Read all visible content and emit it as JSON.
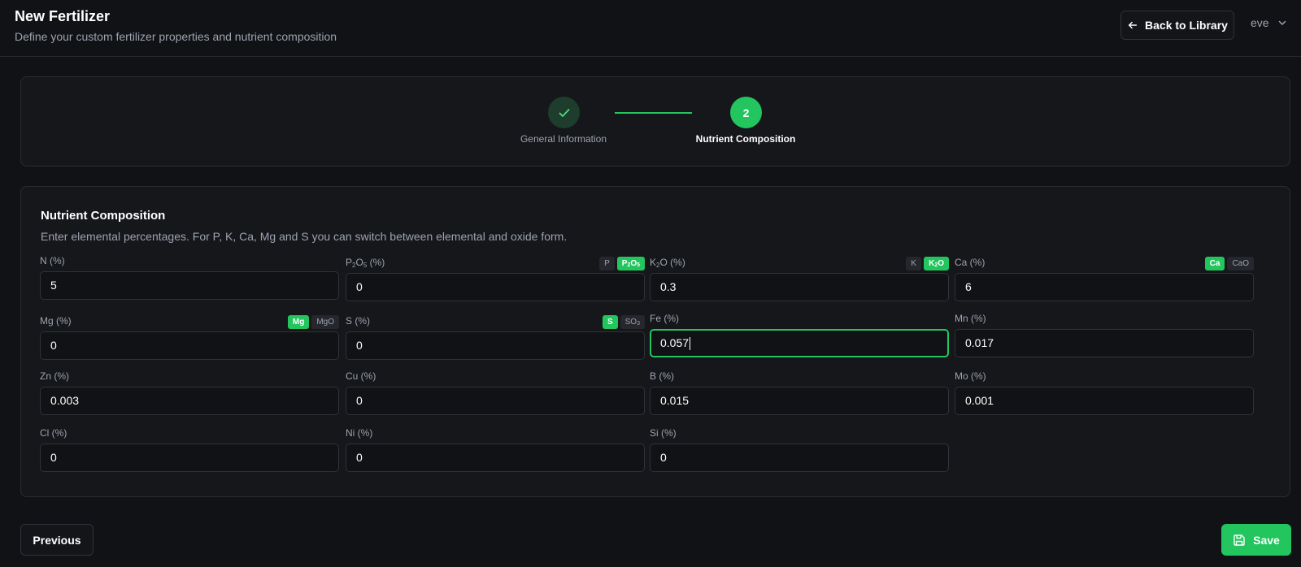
{
  "header": {
    "title": "New Fertilizer",
    "subtitle": "Define your custom fertilizer properties and nutrient composition",
    "back_label": "Back to Library",
    "user": "eve"
  },
  "stepper": {
    "steps": [
      {
        "label": "General Information",
        "state": "completed",
        "icon": "check-icon"
      },
      {
        "label": "Nutrient Composition",
        "state": "current",
        "number": "2"
      }
    ]
  },
  "nutrients": {
    "title": "Nutrient Composition",
    "description": "Enter elemental percentages. For P, K, Ca, Mg and S you can switch between elemental and oxide form.",
    "fields": {
      "n": {
        "label": "N (%)",
        "value": "5"
      },
      "p": {
        "label_main": "P",
        "label_sub1": "2",
        "label_mid": "O",
        "label_sub2": "5",
        "label_tail": " (%)",
        "value": "0",
        "toggle": {
          "elemental": "P",
          "oxide_main": "P",
          "oxide_sub1": "2",
          "oxide_mid": "O",
          "oxide_sub2": "5",
          "active": "oxide"
        }
      },
      "k": {
        "label_main": "K",
        "label_sub1": "2",
        "label_mid": "O",
        "label_tail": " (%)",
        "value": "0.3",
        "toggle": {
          "elemental": "K",
          "oxide_main": "K",
          "oxide_sub1": "2",
          "oxide_mid": "O",
          "active": "oxide"
        }
      },
      "ca": {
        "label": "Ca (%)",
        "value": "6",
        "toggle": {
          "elemental": "Ca",
          "oxide": "CaO",
          "active": "elemental"
        }
      },
      "mg": {
        "label": "Mg (%)",
        "value": "0",
        "toggle": {
          "elemental": "Mg",
          "oxide": "MgO",
          "active": "elemental"
        }
      },
      "s": {
        "label": "S (%)",
        "value": "0",
        "toggle": {
          "elemental": "S",
          "oxide_main": "SO",
          "oxide_sub": "3",
          "active": "elemental"
        }
      },
      "fe": {
        "label": "Fe (%)",
        "value": "0.057",
        "focused": true
      },
      "mn": {
        "label": "Mn (%)",
        "value": "0.017"
      },
      "zn": {
        "label": "Zn (%)",
        "value": "0.003"
      },
      "cu": {
        "label": "Cu (%)",
        "value": "0"
      },
      "b": {
        "label": "B (%)",
        "value": "0.015"
      },
      "mo": {
        "label": "Mo (%)",
        "value": "0.001"
      },
      "cl": {
        "label": "Cl (%)",
        "value": "0"
      },
      "ni": {
        "label": "Ni (%)",
        "value": "0"
      },
      "si": {
        "label": "Si (%)",
        "value": "0"
      }
    }
  },
  "footer": {
    "previous_label": "Previous",
    "save_label": "Save"
  },
  "colors": {
    "accent": "#22c55e",
    "background": "#111216",
    "card": "#16171b"
  }
}
